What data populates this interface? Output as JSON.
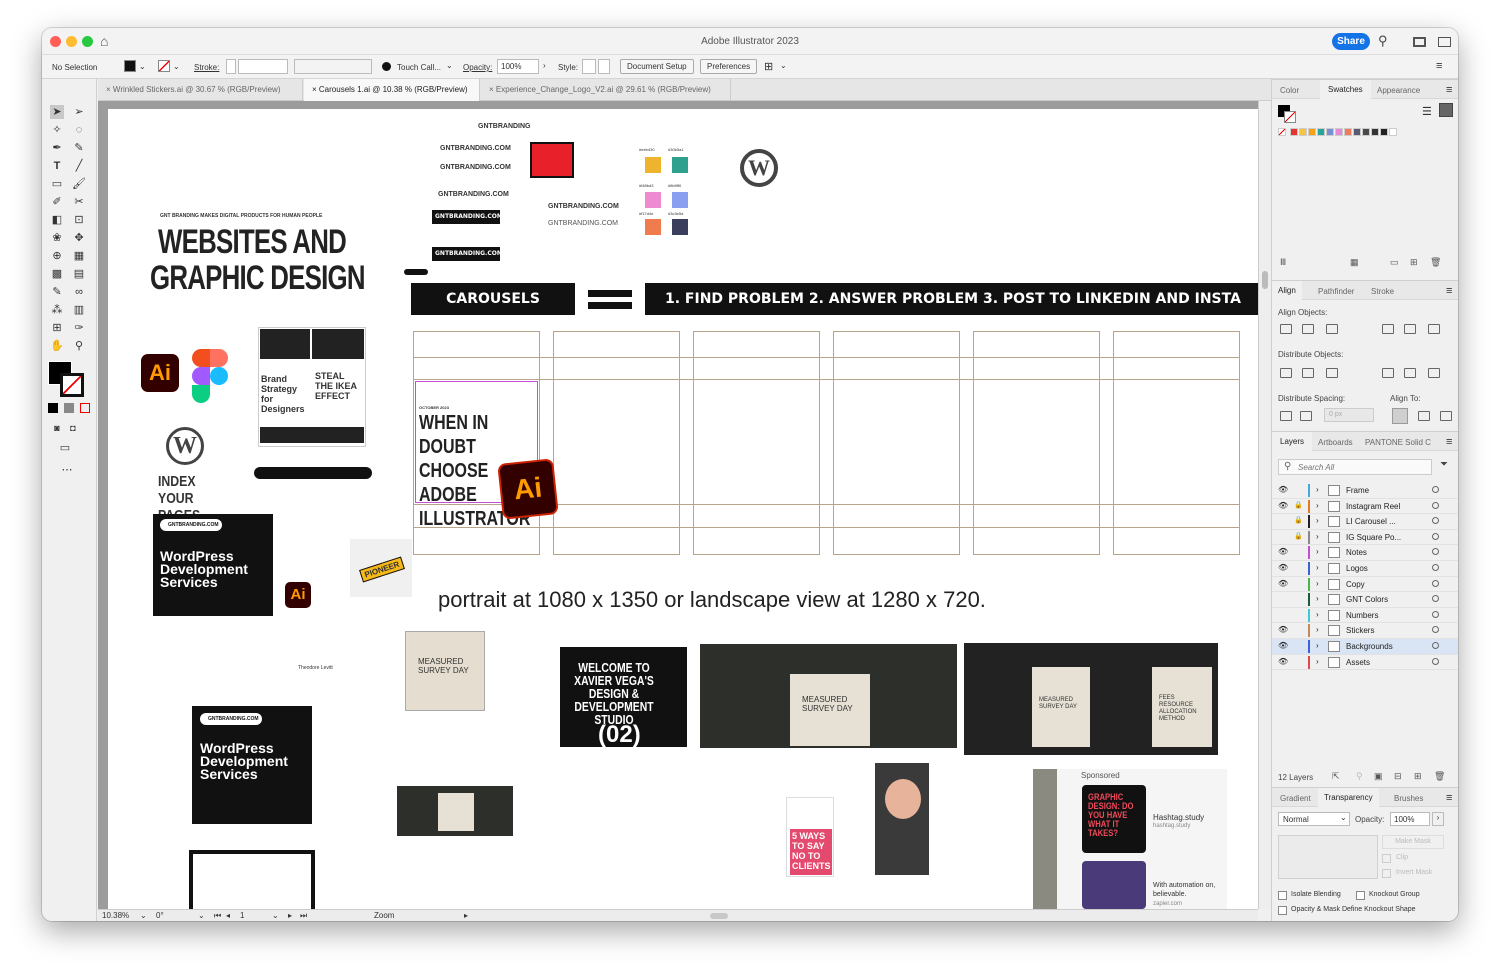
{
  "app": {
    "title": "Adobe Illustrator 2023",
    "share_label": "Share"
  },
  "control_bar": {
    "selection": "No Selection",
    "stroke_label": "Stroke:",
    "brush": "Touch Call...",
    "opacity_label": "Opacity:",
    "opacity_value": "100%",
    "style_label": "Style:",
    "document_setup": "Document Setup",
    "preferences": "Preferences"
  },
  "doc_tabs": [
    {
      "label": "Wrinkled Stickers.ai @ 30.67 % (RGB/Preview)",
      "active": false
    },
    {
      "label": "Carousels 1.ai @ 10.38 % (RGB/Preview)",
      "active": true
    },
    {
      "label": "Experience_Change_Logo_V2.ai @ 29.61 % (RGB/Preview)",
      "active": false
    }
  ],
  "status": {
    "zoom": "10.38%",
    "rotation": "0°",
    "artboard": "1",
    "tool": "Zoom"
  },
  "panels": {
    "color_tabs": [
      "Color",
      "Swatches",
      "Appearance"
    ],
    "swatch_colors": [
      "#e3342f",
      "#f6c343",
      "#f4a316",
      "#26a69a",
      "#7b8fd6",
      "#e48ad6",
      "#ee7c5a",
      "#5a5a70",
      "#4a4a4a",
      "#333333",
      "#222222",
      "#ffffff"
    ],
    "align_tabs": [
      "Align",
      "Pathfinder",
      "Stroke"
    ],
    "align_objects": "Align Objects:",
    "distribute_objects": "Distribute Objects:",
    "distribute_spacing": "Distribute Spacing:",
    "align_to": "Align To:",
    "spacing_value": "0 px",
    "layers_tabs": [
      "Layers",
      "Artboards",
      "PANTONE Solid C"
    ],
    "search_placeholder": "Search All",
    "layers": [
      {
        "name": "Frame",
        "color": "#49a8d8",
        "eye": true,
        "lock": false
      },
      {
        "name": "Instagram Reel",
        "color": "#e07a2a",
        "eye": true,
        "lock": true
      },
      {
        "name": "LI Carousel ...",
        "color": "#222222",
        "eye": false,
        "lock": true
      },
      {
        "name": "IG Square Po...",
        "color": "#888888",
        "eye": false,
        "lock": true
      },
      {
        "name": "Notes",
        "color": "#c44fd6",
        "eye": true,
        "lock": false
      },
      {
        "name": "Logos",
        "color": "#3a62d6",
        "eye": true,
        "lock": false
      },
      {
        "name": "Copy",
        "color": "#4ab546",
        "eye": true,
        "lock": false
      },
      {
        "name": "GNT Colors",
        "color": "#1c5a3c",
        "eye": false,
        "lock": false
      },
      {
        "name": "Numbers",
        "color": "#40c8d8",
        "eye": false,
        "lock": false
      },
      {
        "name": "Stickers",
        "color": "#c08a5a",
        "eye": true,
        "lock": false
      },
      {
        "name": "Backgrounds",
        "color": "#3a62d6",
        "eye": true,
        "lock": false
      },
      {
        "name": "Assets",
        "color": "#e04a4a",
        "eye": true,
        "lock": false
      }
    ],
    "layer_count": "12 Layers",
    "trans_tabs": [
      "Gradient",
      "Transparency",
      "Brushes"
    ],
    "blend_mode": "Normal",
    "opacity_label": "Opacity:",
    "opacity_value": "100%",
    "make_mask": "Make Mask",
    "clip": "Clip",
    "invert_mask": "Invert Mask",
    "isolate_blending": "Isolate Blending",
    "knockout_group": "Knockout Group",
    "opacity_mask_label": "Opacity & Mask Define Knockout Shape"
  },
  "canvas": {
    "brand_small": "GNTBRANDING",
    "brand_url": "GNTBRANDING.COM",
    "tagline": "GNT BRANDING MAKES DIGITAL PRODUCTS FOR HUMAN PEOPLE",
    "headline1": "WEBSITES AND",
    "headline2": "GRAPHIC DESIGN",
    "carousels": "CAROUSELS",
    "steps": "1. FIND PROBLEM  2. ANSWER PROBLEM  3. POST TO LINKEDIN AND INSTA",
    "slide_meta": "OCTOBER 2023",
    "slide_title": "WHEN IN DOUBT CHOOSE ADOBE ILLUSTRATOR",
    "caption": "portrait at 1080 x 1350 or landscape view at 1280 x 720.",
    "ai_label": "Ai",
    "swatch_codes": [
      "#eeb430",
      "#30b5a1",
      "#f48bd3",
      "#8b9ff0",
      "#f17d4e",
      "#3c3e5d"
    ],
    "brand_strategy": "Brand Strategy for Designers",
    "ikea": "STEAL THE IKEA EFFECT",
    "index_pages": "INDEX YOUR PAGES",
    "wp_services": "WordPress Development Services",
    "pioneer": "PIONEER",
    "author": "Theodore Levitt",
    "survey": "MEASURED SURVEY DAY",
    "xavier": "WELCOME TO XAVIER VEGA'S DESIGN & DEVELOPMENT STUDIO",
    "xavier_num": "(02)",
    "fees": "FEES RESOURCE ALLOCATION METHOD",
    "five_ways": "5 WAYS TO SAY NO TO CLIENTS",
    "sponsored": "Sponsored",
    "graphic_q": "GRAPHIC DESIGN: DO YOU HAVE WHAT IT TAKES?",
    "hashtag": "Hashtag.study",
    "hashtag_url": "hashtag.study",
    "automation": "With automation on, believable.",
    "zapier": "zapier.com"
  }
}
